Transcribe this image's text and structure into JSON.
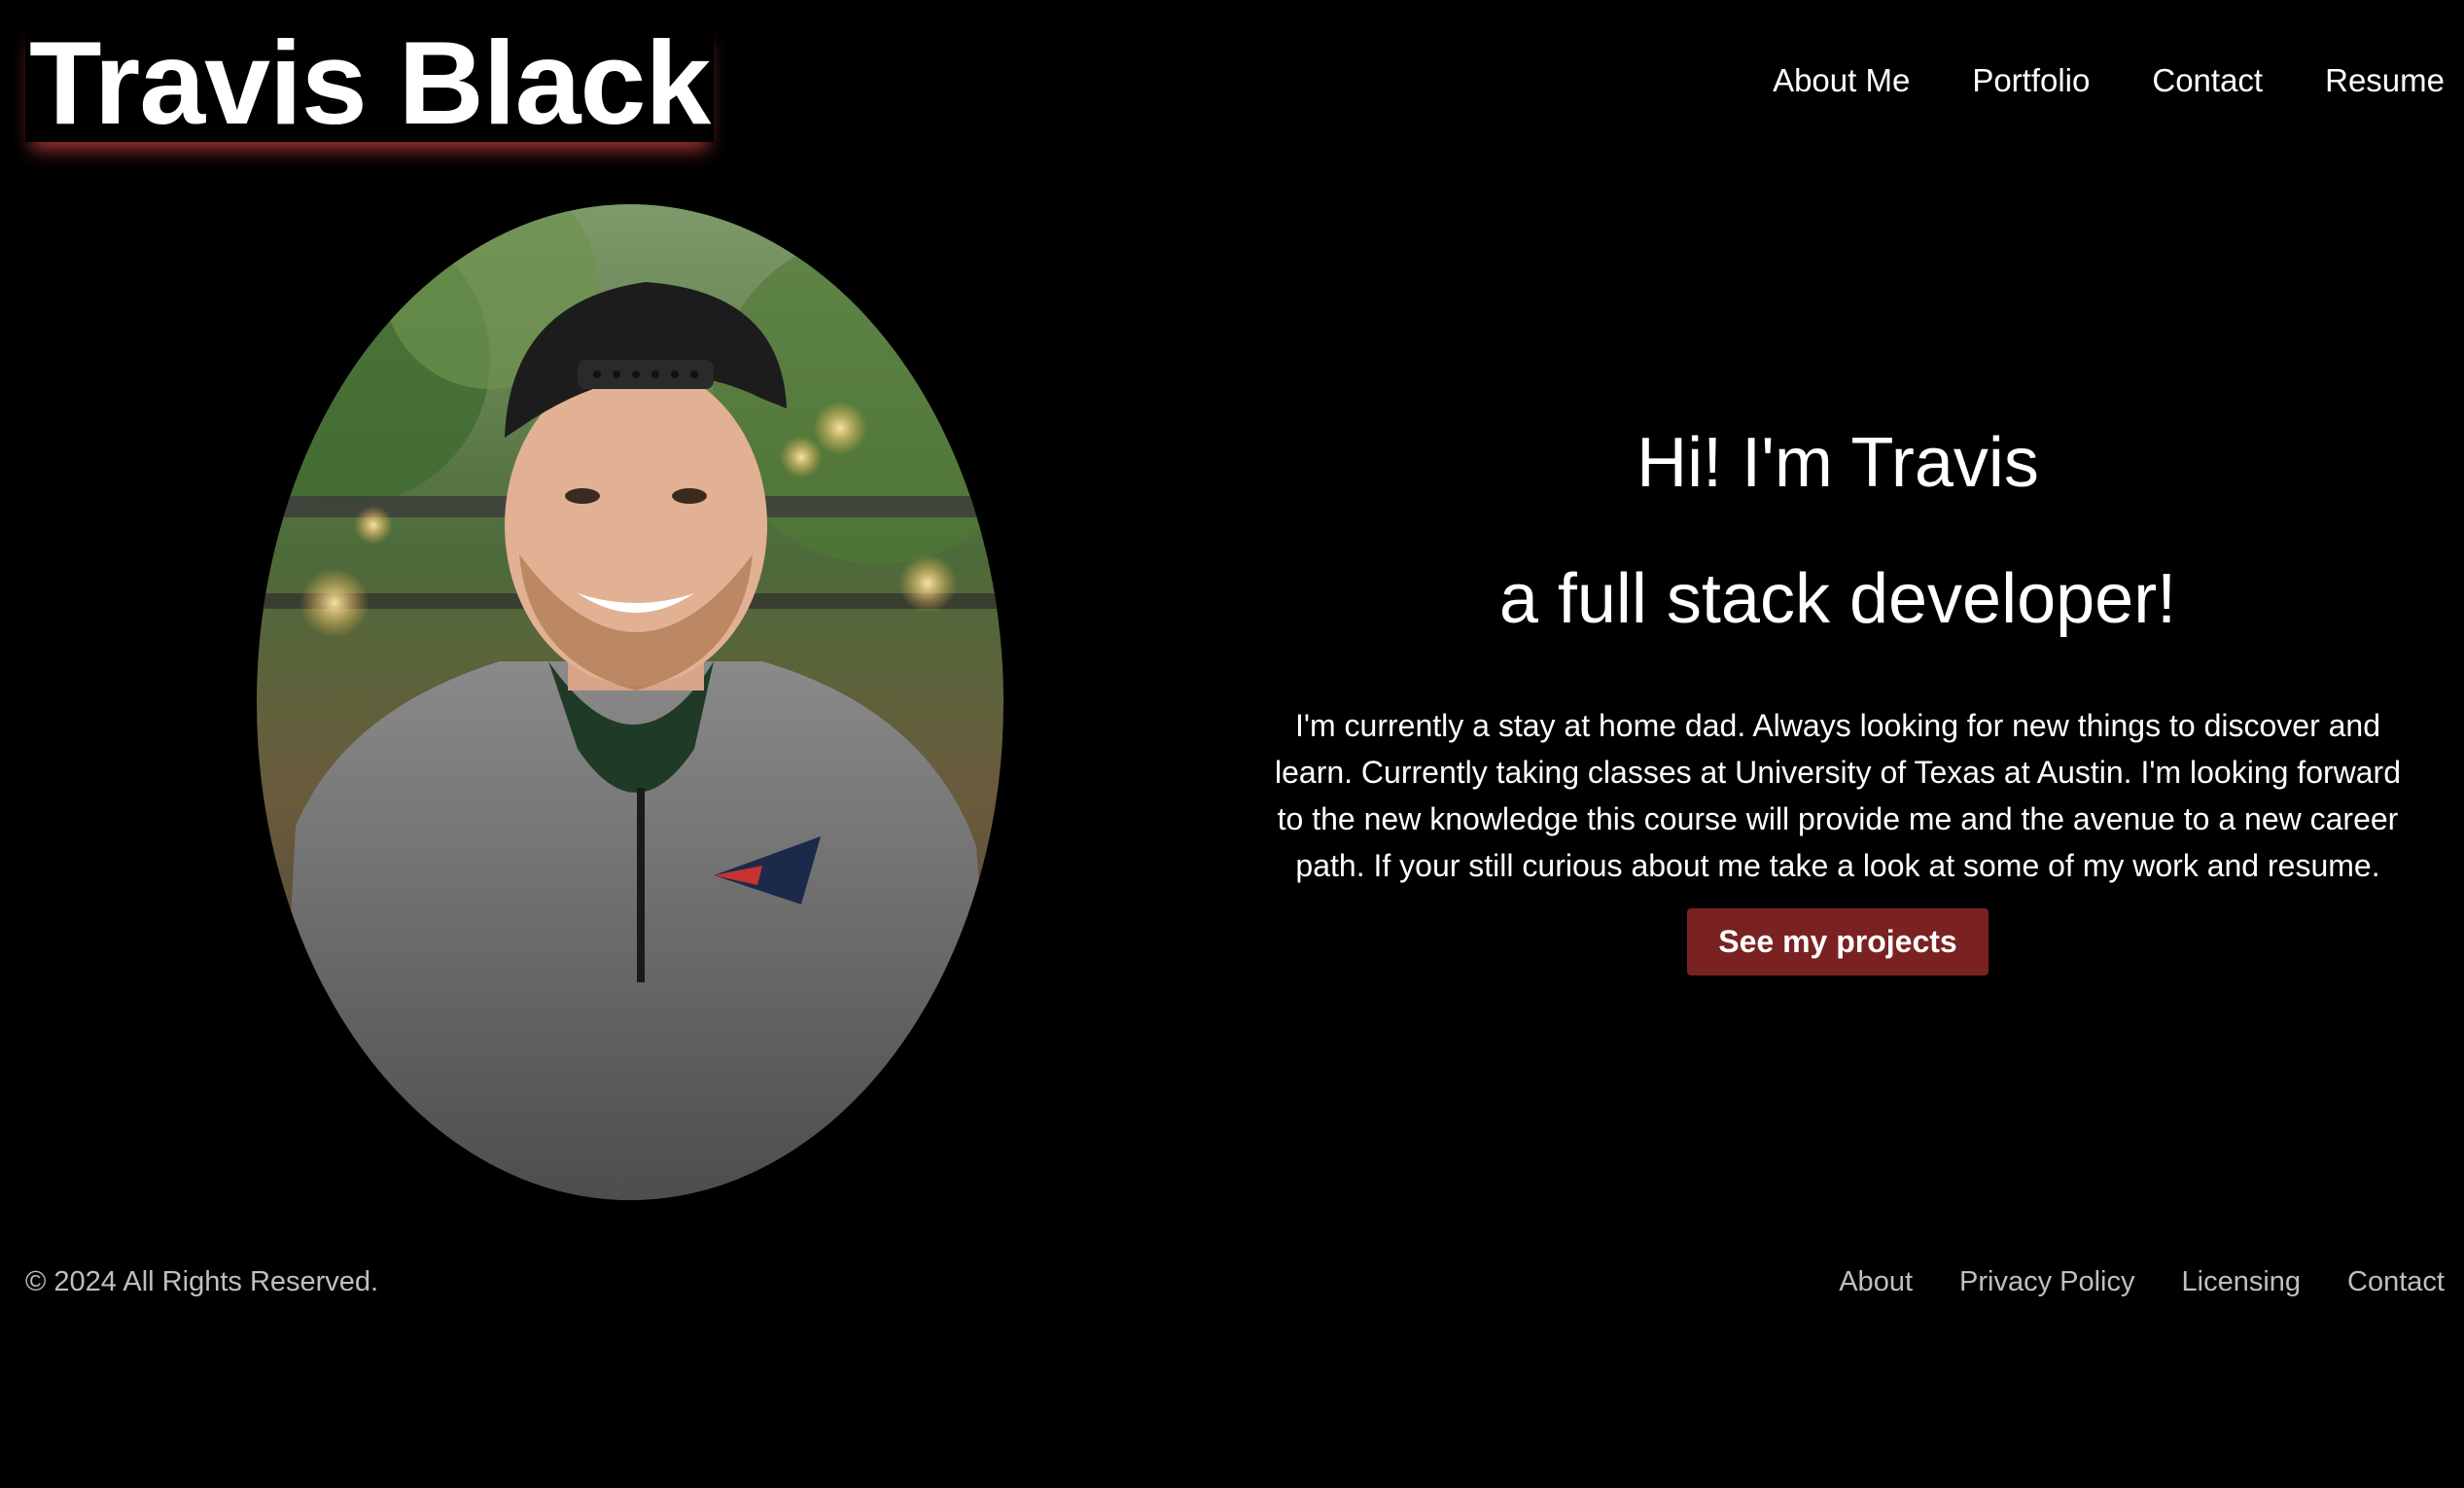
{
  "header": {
    "brand": "Travis Black",
    "nav": [
      "About Me",
      "Portfolio",
      "Contact",
      "Resume"
    ]
  },
  "hero": {
    "title": "Hi! I'm Travis",
    "subtitle": "a full stack developer!",
    "bio": "I'm currently a stay at home dad. Always looking for new things to discover and learn. Currently taking classes at University of Texas at Austin. I'm looking forward to the new knowledge this course will provide me and the avenue to a new career path. If your still curious about me take a look at some of my work and resume.",
    "cta_label": "See my projects",
    "photo_icon": "profile-photo"
  },
  "footer": {
    "copyright": "© 2024 All Rights Reserved.",
    "links": [
      "About",
      "Privacy Policy",
      "Licensing",
      "Contact"
    ]
  },
  "colors": {
    "background": "#000000",
    "text": "#ffffff",
    "muted_text": "#bfbfbf",
    "accent": "#7a2222",
    "brand_glow": "#d24646"
  }
}
